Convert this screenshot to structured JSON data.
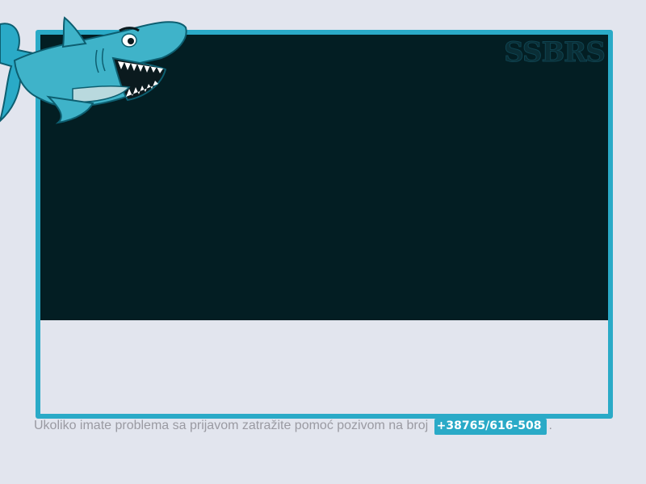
{
  "brand": {
    "logo_text": "SSBRS",
    "mascot": "shark-mascot"
  },
  "footer": {
    "help_text": "Ukoliko imate problema sa prijavom zatražite pomoć pozivom na broj",
    "phone": "+38765/616-508",
    "trailing": "."
  },
  "colors": {
    "accent": "#2aaac7",
    "screen_bg": "#031e23",
    "page_bg": "#e2e5ee",
    "help_text": "#9a9aa2"
  }
}
